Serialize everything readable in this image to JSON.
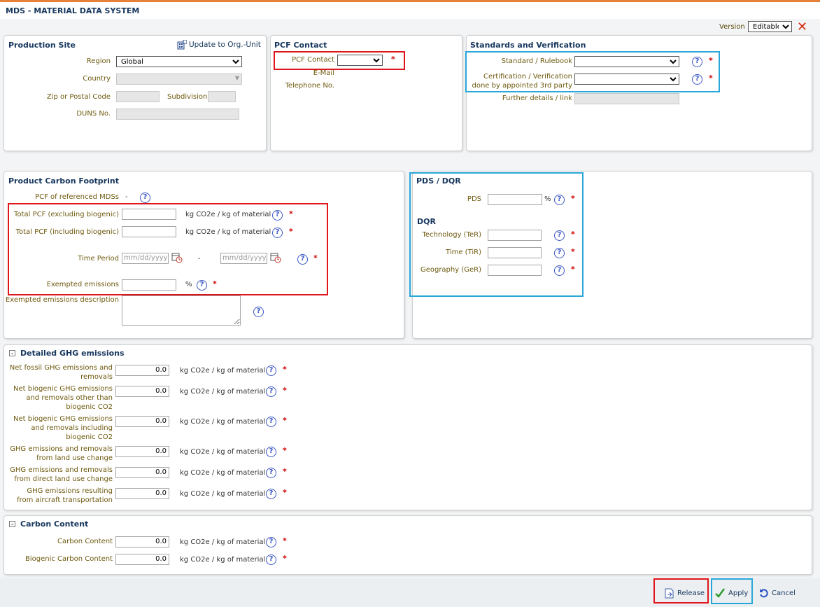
{
  "app": {
    "title": "MDS - MATERIAL DATA SYSTEM",
    "version_label": "Version",
    "version_value": "Editable",
    "version_options": [
      "Editable"
    ]
  },
  "production_site": {
    "title": "Production Site",
    "update_link": "Update to Org.-Unit",
    "region_label": "Region",
    "region_value": "Global",
    "country_label": "Country",
    "zip_label": "Zip or Postal Code",
    "subdivision_label": "Subdivision",
    "duns_label": "DUNS No."
  },
  "pcf_contact": {
    "title": "PCF Contact",
    "contact_label": "PCF Contact",
    "email_label": "E-Mail",
    "phone_label": "Telephone No."
  },
  "standards": {
    "title": "Standards and Verification",
    "standard_label": "Standard / Rulebook",
    "cert_label_1": "Certification / Verification",
    "cert_label_2": "done by appointed 3rd party",
    "details_label": "Further details / link"
  },
  "pcf": {
    "title": "Product Carbon Footprint",
    "referenced_label": "PCF of referenced MDSs",
    "referenced_value": "-",
    "total_excl_label": "Total PCF (excluding biogenic)",
    "total_incl_label": "Total PCF (including biogenic)",
    "unit": "kg CO2e / kg of material",
    "time_period_label": "Time Period",
    "date_placeholder": "mm/dd/yyyy",
    "date_sep": "-",
    "exempted_label": "Exempted emissions",
    "percent": "%",
    "exempted_desc_label": "Exempted emissions description"
  },
  "pds_dqr": {
    "title": "PDS / DQR",
    "pds_label": "PDS",
    "percent": "%",
    "dqr_title": "DQR",
    "ter_label": "Technology (TeR)",
    "tir_label": "Time (TiR)",
    "ger_label": "Geography (GeR)"
  },
  "ghg": {
    "title": "Detailed GHG emissions",
    "toggle": "⌄",
    "unit": "kg CO2e / kg of material",
    "rows": [
      {
        "l1": "Net fossil GHG emissions and",
        "l2": "removals",
        "l3": "",
        "value": "0.0"
      },
      {
        "l1": "Net biogenic GHG emissions",
        "l2": "and removals other than",
        "l3": "biogenic CO2",
        "value": "0.0"
      },
      {
        "l1": "Net biogenic GHG emissions",
        "l2": "and removals including",
        "l3": "biogenic CO2",
        "value": "0.0"
      },
      {
        "l1": "GHG emissions and removals",
        "l2": "from land use change",
        "l3": "",
        "value": "0.0"
      },
      {
        "l1": "GHG emissions and removals",
        "l2": "from direct land use change",
        "l3": "",
        "value": "0.0"
      },
      {
        "l1": "GHG emissions resulting",
        "l2": "from aircraft transportation",
        "l3": "",
        "value": "0.0"
      }
    ]
  },
  "carbon": {
    "title": "Carbon Content",
    "unit": "kg CO2e / kg of material",
    "rows": [
      {
        "label": "Carbon Content",
        "value": "0.0"
      },
      {
        "label": "Biogenic Carbon Content",
        "value": "0.0"
      }
    ]
  },
  "common": {
    "help": "?",
    "required": "*"
  },
  "footer": {
    "release": "Release",
    "apply": "Apply",
    "cancel": "Cancel"
  },
  "colors": {
    "title": "#17375e",
    "label": "#6e5a0f",
    "required": "#d10000",
    "red_highlight": "#e0151b",
    "blue_highlight": "#2aa7d9",
    "accent": "#e7813a"
  }
}
